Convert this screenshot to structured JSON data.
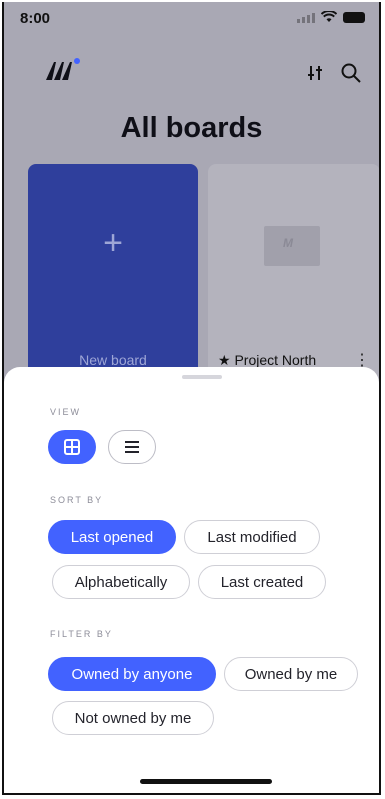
{
  "status": {
    "time": "8:00"
  },
  "app": {
    "title": "All boards"
  },
  "boards": {
    "new_board_label": "New board",
    "new_board_plus": "+",
    "project_label": "★ Project North",
    "project_more": "⋮"
  },
  "sheet": {
    "view_label": "VIEW",
    "sort_label": "SORT BY",
    "filter_label": "FILTER BY",
    "sort_options": [
      "Last opened",
      "Last modified",
      "Alphabetically",
      "Last created"
    ],
    "filter_options": [
      "Owned by anyone",
      "Owned by me",
      "Not owned by me"
    ]
  },
  "colors": {
    "accent": "#4262ff",
    "dim_overlay": "#a9a8b4",
    "new_board_bg": "#2f3f9c"
  },
  "icons": [
    "app-logo-icon",
    "filter-icon",
    "search-icon",
    "grid-view-icon",
    "list-view-icon"
  ]
}
